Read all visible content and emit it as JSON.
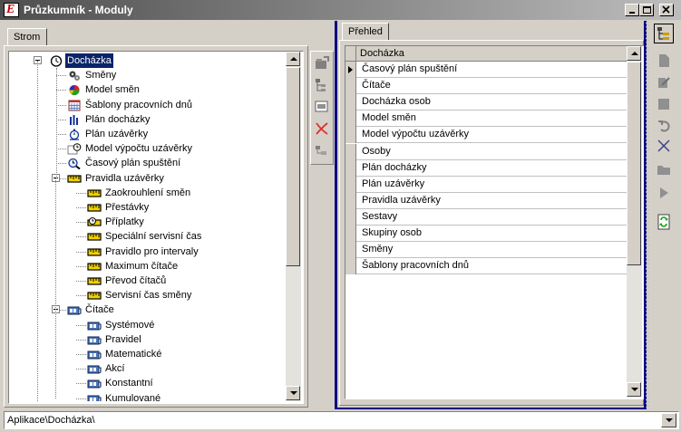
{
  "window": {
    "title": "Průzkumník - Moduly",
    "app_icon_letter": "E"
  },
  "left_tab": {
    "label": "Strom"
  },
  "right_tab": {
    "label": "Přehled"
  },
  "tree": {
    "items": [
      {
        "label": "Docházka",
        "icon": "clock-icon",
        "selected": true
      },
      {
        "label": "Směny",
        "icon": "gears-icon"
      },
      {
        "label": "Model směn",
        "icon": "pie-chart-icon"
      },
      {
        "label": "Šablony pracovních dnů",
        "icon": "calendar-grid-icon"
      },
      {
        "label": "Plán docházky",
        "icon": "bar-chart-icon"
      },
      {
        "label": "Plán uzávěrky",
        "icon": "stopwatch-icon"
      },
      {
        "label": "Model výpočtu uzávěrky",
        "icon": "clock-doc-icon"
      },
      {
        "label": "Časový plán spuštění",
        "icon": "timer-search-icon"
      },
      {
        "label": "Pravidla uzávěrky",
        "icon": "ruler-icon"
      },
      {
        "label": "Zaokrouhlení směn",
        "icon": "ruler-icon"
      },
      {
        "label": "Přestávky",
        "icon": "ruler-icon"
      },
      {
        "label": "Příplatky",
        "icon": "ruler-clock-icon"
      },
      {
        "label": "Speciální servisní čas",
        "icon": "ruler-icon"
      },
      {
        "label": "Pravidlo pro intervaly",
        "icon": "ruler-icon"
      },
      {
        "label": "Maximum čítače",
        "icon": "ruler-icon"
      },
      {
        "label": "Převod čítačů",
        "icon": "ruler-icon"
      },
      {
        "label": "Servisní čas směny",
        "icon": "ruler-icon"
      },
      {
        "label": "Čítače",
        "icon": "counter-icon"
      },
      {
        "label": "Systémové",
        "icon": "counter-icon"
      },
      {
        "label": "Pravidel",
        "icon": "counter-icon"
      },
      {
        "label": "Matematické",
        "icon": "counter-icon"
      },
      {
        "label": "Akcí",
        "icon": "counter-icon"
      },
      {
        "label": "Konstantní",
        "icon": "counter-icon"
      },
      {
        "label": "Kumulované",
        "icon": "counter-icon"
      }
    ]
  },
  "grid": {
    "header": "Docházka",
    "rows": [
      "Časový plán spuštění",
      "Čítače",
      "Docházka osob",
      "Model směn",
      "Model výpočtu uzávěrky",
      "Osoby",
      "Plán docházky",
      "Plán uzávěrky",
      "Pravidla uzávěrky",
      "Sestavy",
      "Skupiny osob",
      "Směny",
      "Šablony pracovních dnů"
    ]
  },
  "path_combo": {
    "value": "Aplikace\\Docházka\\"
  },
  "colors": {
    "tree_bg": "#ffffff",
    "selection": "#0a246a",
    "accent_border": "#000080"
  }
}
